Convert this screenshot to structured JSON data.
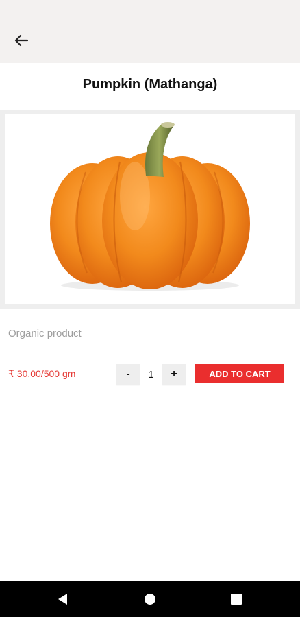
{
  "header": {
    "back_icon": "arrow-left-icon"
  },
  "product": {
    "title": "Pumpkin (Mathanga)",
    "image": "pumpkin-photo",
    "description": "Organic product",
    "price": "₹ 30.00/500 gm",
    "quantity": "1",
    "minus_label": "-",
    "plus_label": "+",
    "add_to_cart_label": "ADD TO CART"
  },
  "colors": {
    "accent": "#ea2e2e",
    "price": "#e53935",
    "app_bar": "#f3f1f0"
  },
  "navbar": {
    "back_icon": "triangle-back-icon",
    "home_icon": "circle-home-icon",
    "recents_icon": "square-recents-icon"
  }
}
